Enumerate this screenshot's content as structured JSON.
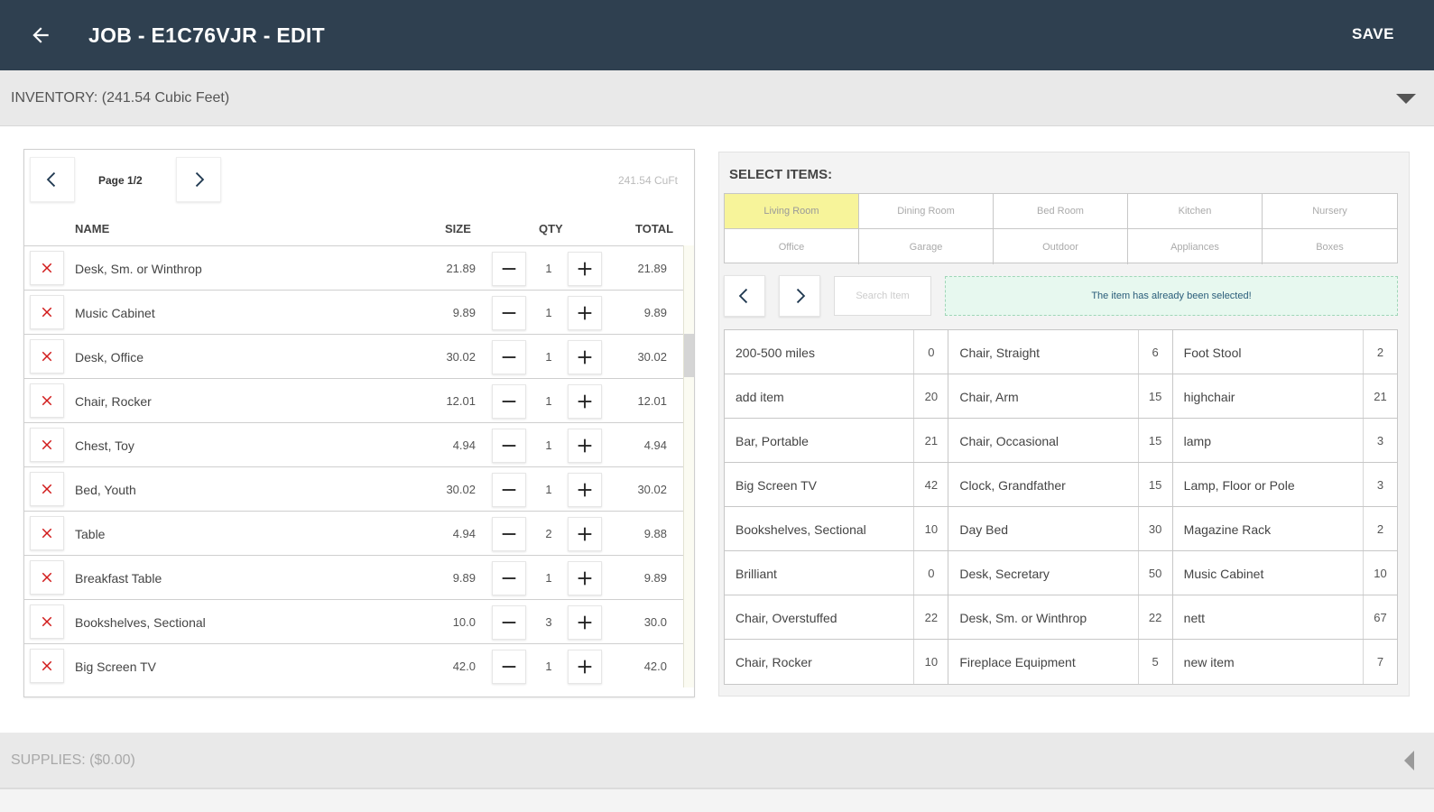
{
  "header": {
    "title": "JOB - E1C76VJR - EDIT",
    "save_label": "SAVE"
  },
  "inventory_bar": {
    "label": "INVENTORY: (241.54 Cubic Feet)"
  },
  "supplies_bar": {
    "label": "SUPPLIES: ($0.00)"
  },
  "inventory": {
    "page_label": "Page 1/2",
    "total_cuft": "241.54 CuFt",
    "columns": {
      "name": "NAME",
      "size": "SIZE",
      "qty": "QTY",
      "total": "TOTAL"
    },
    "rows": [
      {
        "name": "Desk, Sm. or Winthrop",
        "size": "21.89",
        "qty": "1",
        "total": "21.89"
      },
      {
        "name": "Music Cabinet",
        "size": "9.89",
        "qty": "1",
        "total": "9.89"
      },
      {
        "name": "Desk, Office",
        "size": "30.02",
        "qty": "1",
        "total": "30.02"
      },
      {
        "name": "Chair, Rocker",
        "size": "12.01",
        "qty": "1",
        "total": "12.01"
      },
      {
        "name": "Chest, Toy",
        "size": "4.94",
        "qty": "1",
        "total": "4.94"
      },
      {
        "name": "Bed, Youth",
        "size": "30.02",
        "qty": "1",
        "total": "30.02"
      },
      {
        "name": "Table",
        "size": "4.94",
        "qty": "2",
        "total": "9.88"
      },
      {
        "name": "Breakfast Table",
        "size": "9.89",
        "qty": "1",
        "total": "9.89"
      },
      {
        "name": "Bookshelves, Sectional",
        "size": "10.0",
        "qty": "3",
        "total": "30.0"
      },
      {
        "name": "Big Screen TV",
        "size": "42.0",
        "qty": "1",
        "total": "42.0"
      }
    ]
  },
  "select_items": {
    "title": "SELECT ITEMS:",
    "rooms": [
      "Living Room",
      "Dining Room",
      "Bed Room",
      "Kitchen",
      "Nursery",
      "Office",
      "Garage",
      "Outdoor",
      "Appliances",
      "Boxes"
    ],
    "active_room": "Living Room",
    "search_placeholder": "Search Item",
    "notice": "The item has already been selected!",
    "items": [
      {
        "name": "200-500 miles",
        "count": "0"
      },
      {
        "name": "Chair, Straight",
        "count": "6"
      },
      {
        "name": "Foot Stool",
        "count": "2"
      },
      {
        "name": "add item",
        "count": "20"
      },
      {
        "name": "Chair, Arm",
        "count": "15"
      },
      {
        "name": "highchair",
        "count": "21"
      },
      {
        "name": "Bar, Portable",
        "count": "21"
      },
      {
        "name": "Chair, Occasional",
        "count": "15"
      },
      {
        "name": "lamp",
        "count": "3"
      },
      {
        "name": "Big Screen TV",
        "count": "42"
      },
      {
        "name": "Clock, Grandfather",
        "count": "15"
      },
      {
        "name": "Lamp, Floor or Pole",
        "count": "3"
      },
      {
        "name": "Bookshelves, Sectional",
        "count": "10"
      },
      {
        "name": "Day Bed",
        "count": "30"
      },
      {
        "name": "Magazine Rack",
        "count": "2"
      },
      {
        "name": "Brilliant",
        "count": "0"
      },
      {
        "name": "Desk, Secretary",
        "count": "50"
      },
      {
        "name": "Music Cabinet",
        "count": "10"
      },
      {
        "name": "Chair, Overstuffed",
        "count": "22"
      },
      {
        "name": "Desk, Sm. or Winthrop",
        "count": "22"
      },
      {
        "name": "nett",
        "count": "67"
      },
      {
        "name": "Chair, Rocker",
        "count": "10"
      },
      {
        "name": "Fireplace Equipment",
        "count": "5"
      },
      {
        "name": "new item",
        "count": "7"
      }
    ]
  },
  "colors": {
    "topbar": "#2f4050",
    "delete_icon": "#d11a1a",
    "active_room": "#f7f49a",
    "notice_bg": "#e7f8ef"
  },
  "icons": {
    "back": "arrow-left-icon",
    "delete": "close-icon",
    "minus": "minus-icon",
    "plus": "plus-icon",
    "prev": "chevron-left-icon",
    "next": "chevron-right-icon"
  }
}
